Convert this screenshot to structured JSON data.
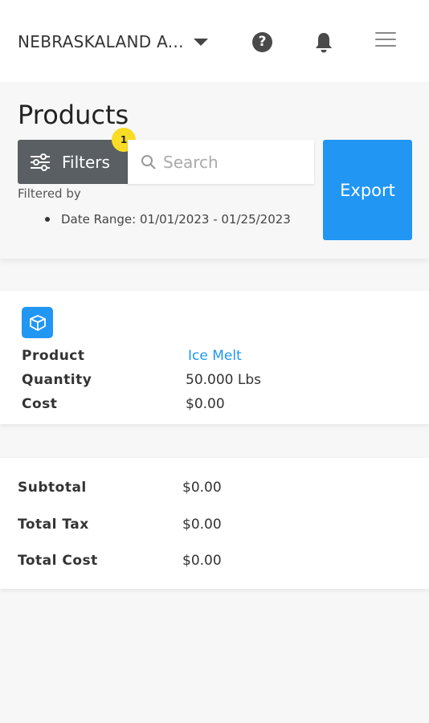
{
  "topbar": {
    "org_name": "NEBRASKALAND A...",
    "help_glyph": "?"
  },
  "page": {
    "title": "Products"
  },
  "filters": {
    "button_label": "Filters",
    "badge_count": "1",
    "search_placeholder": "Search",
    "export_label": "Export",
    "filtered_by_label": "Filtered by",
    "active_filters": [
      "Date Range: 01/01/2023 - 01/25/2023"
    ]
  },
  "product": {
    "rows": [
      {
        "label": "Product",
        "value": "Ice Melt"
      },
      {
        "label": "Quantity",
        "value": "50.000 Lbs"
      },
      {
        "label": "Cost",
        "value": "$0.00"
      }
    ]
  },
  "totals": {
    "rows": [
      {
        "label": "Subtotal",
        "value": "$0.00"
      },
      {
        "label": "Total Tax",
        "value": "$0.00"
      },
      {
        "label": "Total Cost",
        "value": "$0.00"
      }
    ]
  },
  "colors": {
    "accent": "#2196f3",
    "filters_bg": "#5a5f63",
    "badge": "#f9dc26"
  },
  "icons": {
    "org_dropdown": "caret-down-icon",
    "help": "help-circle-icon",
    "notifications": "bell-icon",
    "menu": "hamburger-menu-icon",
    "filters": "sliders-icon",
    "search": "search-icon",
    "product": "box-icon"
  }
}
